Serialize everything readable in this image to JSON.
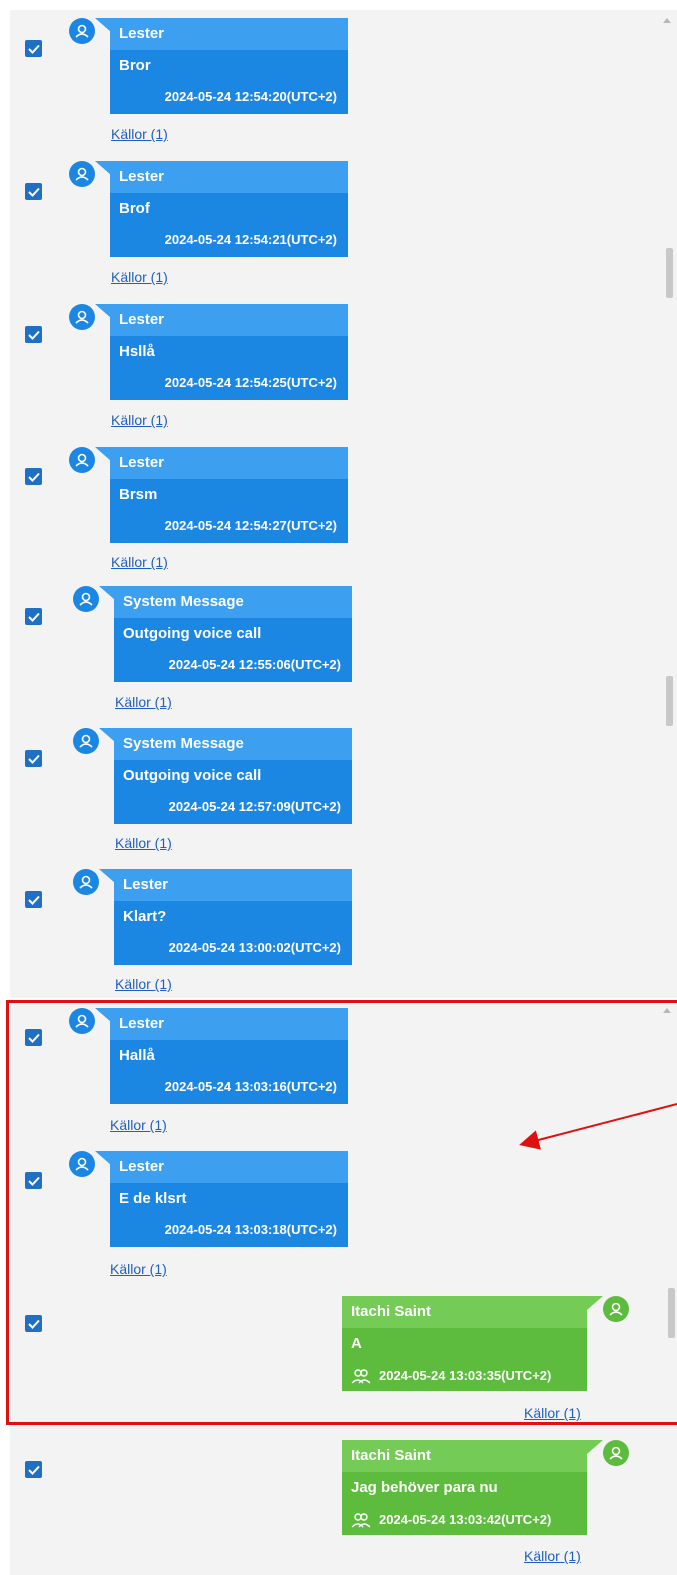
{
  "colors": {
    "contact_bubble": "#1b87e3",
    "contact_header": "#3d9ff0",
    "owner_bubble": "#5dbb3d",
    "owner_header": "#74cb55",
    "checkbox": "#1f6fc5",
    "highlight_box": "#e01010",
    "link": "#1f5fbf"
  },
  "messages": [
    {
      "sender": "Lester",
      "text": "Bror",
      "time": "2024-05-24 12:54:20(UTC+2)",
      "sources": "Källor (1)",
      "checked": true
    },
    {
      "sender": "Lester",
      "text": "Brof",
      "time": "2024-05-24 12:54:21(UTC+2)",
      "sources": "Källor (1)",
      "checked": true
    },
    {
      "sender": "Lester",
      "text": "Hsllå",
      "time": "2024-05-24 12:54:25(UTC+2)",
      "sources": "Källor (1)",
      "checked": true
    },
    {
      "sender": "Lester",
      "text": "Brsm",
      "time": "2024-05-24 12:54:27(UTC+2)",
      "sources": "Källor (1)",
      "checked": true
    },
    {
      "sender": "System Message",
      "text": "Outgoing voice call",
      "time": "2024-05-24 12:55:06(UTC+2)",
      "sources": "Källor (1)",
      "checked": true
    },
    {
      "sender": "System Message",
      "text": "Outgoing voice call",
      "time": "2024-05-24 12:57:09(UTC+2)",
      "sources": "Källor (1)",
      "checked": true
    },
    {
      "sender": "Lester",
      "text": "Klart?",
      "time": "2024-05-24 13:00:02(UTC+2)",
      "sources": "Källor (1)",
      "checked": true
    },
    {
      "sender": "Lester",
      "text": "Hallå",
      "time": "2024-05-24 13:03:16(UTC+2)",
      "sources": "Källor (1)",
      "checked": true
    },
    {
      "sender": "Lester",
      "text": "E de klsrt",
      "time": "2024-05-24 13:03:18(UTC+2)",
      "sources": "Källor (1)",
      "checked": true
    },
    {
      "sender": "Itachi Saint",
      "text": "A",
      "time": "2024-05-24 13:03:35(UTC+2)",
      "sources": "Källor (1)",
      "checked": true,
      "outgoing": true
    },
    {
      "sender": "Itachi Saint",
      "text": "Jag behöver para nu",
      "time": "2024-05-24 13:03:42(UTC+2)",
      "sources": "Källor (1)",
      "checked": true,
      "outgoing": true
    }
  ],
  "icons": {
    "checkbox": "checkmark-icon",
    "avatar": "user-avatar-icon",
    "participants": "participants-icon",
    "scroll_up": "scroll-up-arrow-icon"
  }
}
